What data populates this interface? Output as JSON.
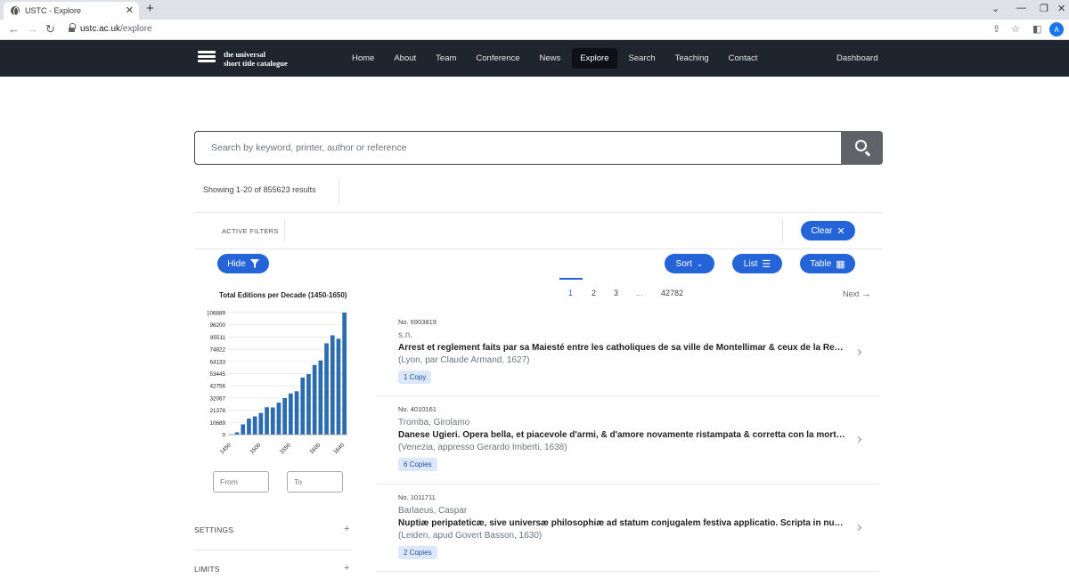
{
  "browser": {
    "tab_title": "USTC - Explore",
    "url_host": "ustc.ac.uk",
    "url_path": "/explore",
    "avatar_letter": "A"
  },
  "site": {
    "logo_line1": "the universal",
    "logo_line2": "short title catalogue",
    "nav": [
      "Home",
      "About",
      "Team",
      "Conference",
      "News",
      "Explore",
      "Search",
      "Teaching",
      "Contact"
    ],
    "active_nav": "Explore",
    "dashboard": "Dashboard"
  },
  "search": {
    "placeholder": "Search by keyword, printer, author or reference"
  },
  "results_count": "Showing 1-20 of 855623 results",
  "filters": {
    "active_label": "ACTIVE FILTERS",
    "clear": "Clear",
    "hide": "Hide",
    "sort": "Sort",
    "list": "List",
    "table": "Table"
  },
  "chart_data": {
    "type": "bar",
    "title": "Total Editions per Decade (1450-1650)",
    "x": [
      1450,
      1460,
      1470,
      1480,
      1490,
      1500,
      1510,
      1520,
      1530,
      1540,
      1550,
      1560,
      1570,
      1580,
      1590,
      1600,
      1610,
      1620,
      1630,
      1640
    ],
    "x_tick_labels": [
      "1450",
      "1500",
      "1550",
      "1600",
      "1640"
    ],
    "y_tick_labels": [
      "0",
      "10689",
      "21378",
      "32067",
      "42756",
      "53445",
      "64133",
      "74822",
      "85511",
      "96200",
      "106889"
    ],
    "values": [
      200,
      2000,
      9000,
      14000,
      16000,
      19000,
      24000,
      23800,
      28000,
      32000,
      36000,
      38000,
      50000,
      53000,
      61000,
      65000,
      80000,
      87000,
      84000,
      106889
    ],
    "ylim": [
      0,
      106889
    ],
    "bar_color": "#2b6cb0",
    "grid": true
  },
  "range": {
    "from_placeholder": "From",
    "to_placeholder": "To"
  },
  "sidebar": {
    "settings": "SETTINGS",
    "limits": "LIMITS"
  },
  "pagination": {
    "pages": [
      "1",
      "2",
      "3",
      "...",
      "42782"
    ],
    "current": "1",
    "next": "Next"
  },
  "results": [
    {
      "number": "No. 6903819",
      "author": "s.n.",
      "title": "Arrest et reglement faits par sa Maiesté entre les catholiques de sa ville de Montellimar & ceux de la Religion prétendue réformée",
      "imprint": "(Lyon, par Claude Armand, 1627)",
      "copies": "1 Copy"
    },
    {
      "number": "No. 4010161",
      "author": "Tromba, Girolamo",
      "title": "Danese Ugieri. Opera bella, et piacevole d'armi, & d'amore novamente ristampata & corretta con la morte di Carlo Magno",
      "imprint": "(Venezia, appresso Gerardo Imberti, 1638)",
      "copies": "6 Copies"
    },
    {
      "number": "No. 1011711",
      "author": "Barlaeus, Caspar",
      "title": "Nuptiæ peripateticæ, sive universæ philosophiæ ad statum conjugalem festiva applicatio. Scripta in nuptias clarissimi viri",
      "imprint": "(Leiden, apud Govert Basson, 1630)",
      "copies": "2 Copies"
    }
  ],
  "colors": {
    "accent": "#2563d9",
    "nav_bg": "#1f252e",
    "search_btn": "#5f6368"
  }
}
